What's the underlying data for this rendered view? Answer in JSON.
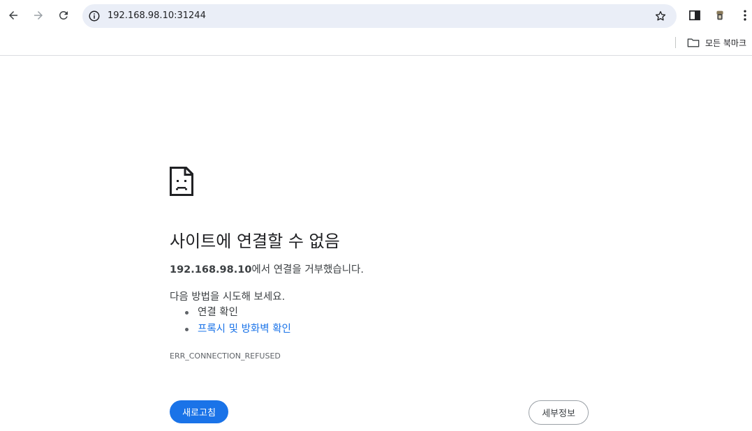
{
  "browser": {
    "url": "192.168.98.10:31244",
    "bookmarks_folder": "모든 북마크",
    "icons": {
      "back": "back-arrow-icon",
      "forward": "forward-arrow-icon",
      "reload": "reload-icon",
      "site_info": "info-icon",
      "bookmark": "star-icon",
      "side_panel": "side-panel-icon",
      "profile": "profile-avatar",
      "menu": "kebab-menu-icon",
      "folder": "folder-icon"
    }
  },
  "error_page": {
    "icon": "sad-page-icon",
    "title": "사이트에 연결할 수 없음",
    "host": "192.168.98.10",
    "desc_suffix": "에서 연결을 거부했습니다.",
    "suggest_label": "다음 방법을 시도해 보세요.",
    "suggestions": [
      "연결 확인",
      "프록시 및 방화벽 확인"
    ],
    "error_code": "ERR_CONNECTION_REFUSED",
    "reload_label": "새로고침",
    "details_label": "세부정보"
  },
  "colors": {
    "accent": "#1a73e8",
    "omnibox_bg": "#eaeef7"
  }
}
